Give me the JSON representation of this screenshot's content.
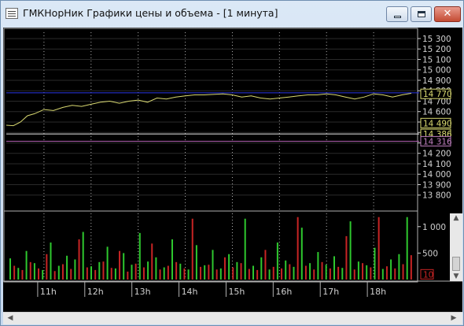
{
  "window": {
    "title": "ГМКНорНик Графики цены и объема - [1 минута]",
    "close_label": "✕"
  },
  "colors": {
    "background": "#000000",
    "price_line": "#d8d870",
    "grid": "#b0b0b0",
    "blue_level": "#2a36e6",
    "magenta_level": "#b060b0",
    "volume_up": "#2ec82e",
    "volume_down": "#c82424",
    "axis_text": "#d0d0d0"
  },
  "chart_data": [
    {
      "type": "line",
      "title": "",
      "y_ticks": [
        "15 300",
        "15 200",
        "15 100",
        "15 000",
        "14 900",
        "14 800",
        "14 700",
        "14 600",
        "14 500",
        "14 400",
        "14 300",
        "14 200",
        "14 100",
        "14 000",
        "13 900",
        "13 800"
      ],
      "ylim": [
        13700,
        15360
      ],
      "price_labels": [
        {
          "text": "14 770",
          "value": 14770,
          "color": "#d8d870"
        },
        {
          "text": "14 490",
          "value": 14490,
          "color": "#d8d870"
        },
        {
          "text": "14 386",
          "value": 14386,
          "color": "#d8d870"
        },
        {
          "text": "14 316",
          "value": 14316,
          "color": "#c080c0"
        }
      ],
      "levels": [
        {
          "value": 14780,
          "color": "#2a36e6"
        },
        {
          "value": 14386,
          "color": "#e8e8e8"
        },
        {
          "value": 14316,
          "color": "#b060b0"
        }
      ],
      "series": [
        {
          "x": [
            10.2,
            10.35,
            10.5,
            10.65,
            10.8,
            11.0,
            11.2,
            11.4,
            11.6,
            11.8,
            12.0,
            12.2,
            12.4,
            12.6,
            12.8,
            13.0,
            13.2,
            13.4,
            13.6,
            13.8,
            14.0,
            14.2,
            14.4,
            14.6,
            14.8,
            15.0,
            15.2,
            15.4,
            15.6,
            15.8,
            16.0,
            16.2,
            16.4,
            16.6,
            16.8,
            17.0,
            17.2,
            17.4,
            17.6,
            17.8,
            18.0,
            18.2,
            18.4,
            18.6,
            18.8
          ],
          "y": [
            14470,
            14465,
            14500,
            14560,
            14580,
            14620,
            14610,
            14640,
            14660,
            14650,
            14670,
            14690,
            14700,
            14680,
            14700,
            14710,
            14690,
            14730,
            14720,
            14740,
            14750,
            14760,
            14760,
            14765,
            14770,
            14760,
            14740,
            14750,
            14730,
            14720,
            14730,
            14740,
            14750,
            14760,
            14760,
            14770,
            14760,
            14740,
            14720,
            14740,
            14770,
            14760,
            14740,
            14760,
            14775
          ]
        }
      ]
    },
    {
      "type": "bar",
      "title": "",
      "y_ticks": [
        "1 000",
        "500"
      ],
      "ylim": [
        0,
        1250
      ],
      "volume_label": "10",
      "x_ticks": [
        "11h",
        "12h",
        "13h",
        "14h",
        "15h",
        "16h",
        "17h",
        "18h"
      ],
      "x_tick_values": [
        11,
        12,
        13,
        14,
        15,
        16,
        17,
        18
      ],
      "xlim": [
        10.2,
        18.9
      ],
      "series": [
        {
          "name": "",
          "values_up": [
            400,
            220,
            540,
            310,
            180,
            700,
            260,
            450,
            380,
            900,
            250,
            330,
            620,
            210,
            500,
            280,
            880,
            340,
            420,
            230,
            760,
            300,
            190,
            650,
            270,
            560,
            210,
            480,
            330,
            1150,
            260,
            420,
            190,
            700,
            360,
            240,
            980,
            310,
            520,
            280,
            440,
            220,
            1100,
            340,
            270,
            600,
            200,
            380,
            480,
            1180
          ]
        },
        {
          "name": "",
          "values_down": [
            260,
            180,
            330,
            210,
            480,
            160,
            290,
            200,
            760,
            230,
            180,
            340,
            220,
            540,
            150,
            300,
            230,
            680,
            190,
            260,
            330,
            210,
            1150,
            240,
            280,
            190,
            420,
            230,
            310,
            200,
            180,
            560,
            240,
            210,
            290,
            1180,
            260,
            190,
            330,
            210,
            240,
            820,
            190,
            310,
            230,
            1180,
            250,
            210,
            290,
            460
          ]
        }
      ]
    }
  ],
  "scrollbars": {
    "left_arrow": "◀",
    "right_arrow": "▶",
    "up_arrow": "▲",
    "down_arrow": "▼"
  }
}
